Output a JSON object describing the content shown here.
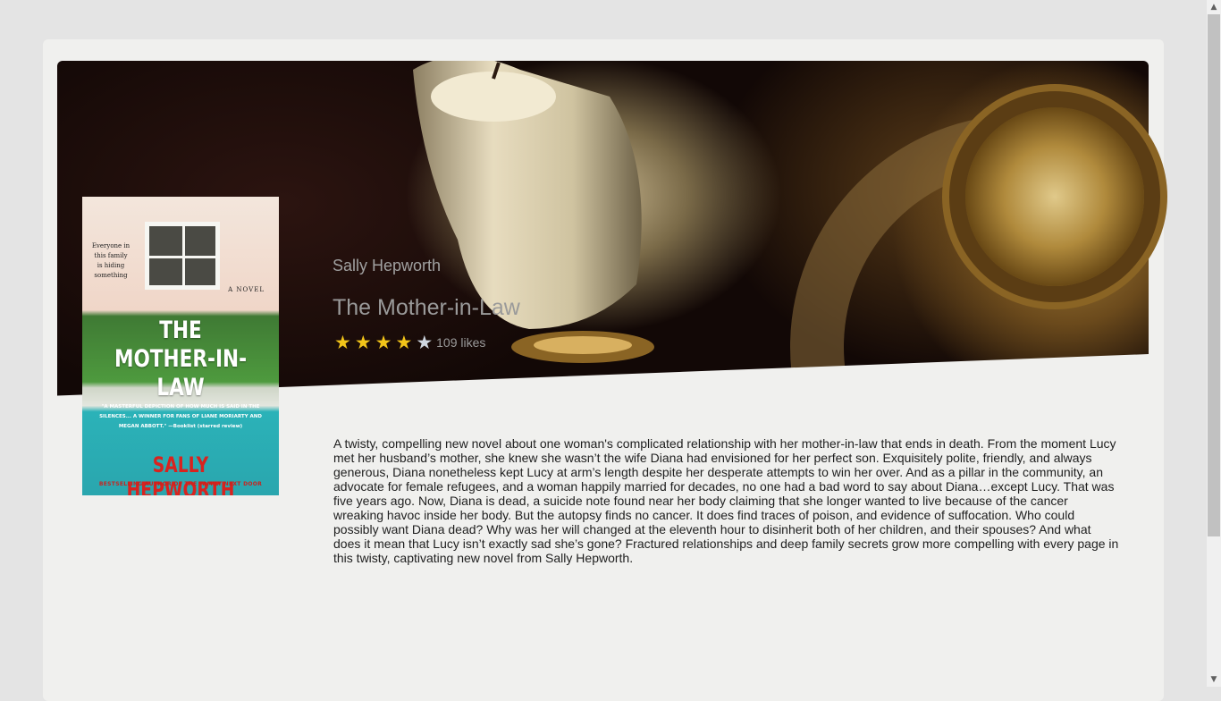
{
  "book": {
    "author": "Sally Hepworth",
    "title": "The Mother-in-Law",
    "rating": 4,
    "max_rating": 5,
    "likes_text": "109 likes",
    "description": "A twisty, compelling new novel about one woman's complicated relationship with her mother-in-law that ends in death. From the moment Lucy met her husband’s mother, she knew she wasn’t the wife Diana had envisioned for her perfect son. Exquisitely polite, friendly, and always generous, Diana nonetheless kept Lucy at arm’s length despite her desperate attempts to win her over. And as a pillar in the community, an advocate for female refugees, and a woman happily married for decades, no one had a bad word to say about Diana…except Lucy. That was five years ago. Now, Diana is dead, a suicide note found near her body claiming that she longer wanted to live because of the cancer wreaking havoc inside her body. But the autopsy finds no cancer. It does find traces of poison, and evidence of suffocation. Who could possibly want Diana dead? Why was her will changed at the eleventh hour to disinherit both of her children, and their spouses? And what does it mean that Lucy isn’t exactly sad she’s gone? Fractured relationships and deep family secrets grow more compelling with every page in this twisty, captivating new novel from Sally Hepworth."
  },
  "cover": {
    "tagline": "Everyone in this family is hiding something",
    "novel_label": "A NOVEL",
    "title_line1": "THE",
    "title_line2": "MOTHER-IN-LAW",
    "quote": "\"A MASTERFUL DEPICTION OF HOW MUCH IS SAID IN THE SILENCES... A WINNER FOR FANS OF LIANE MORIARTY AND MEGAN ABBOTT.\" —Booklist (starred review)",
    "author": "SALLY HEPWORTH",
    "byline": "BESTSELLING AUTHOR OF THE FAMILY NEXT DOOR"
  },
  "stars": [
    "star-filled",
    "star-filled",
    "star-filled",
    "star-filled",
    "star-empty"
  ],
  "colors": {
    "star_on": "#f2c419",
    "star_off": "#cfd6e0",
    "page_bg": "#e4e4e4",
    "card_bg": "#f0f0ee"
  }
}
